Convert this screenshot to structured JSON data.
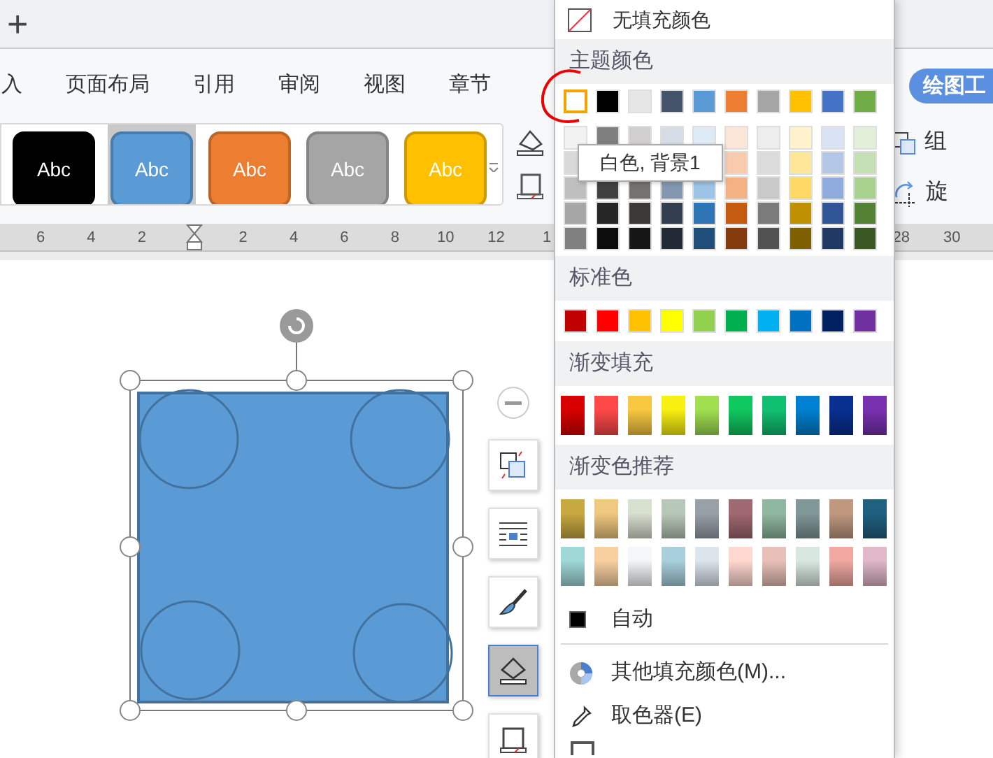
{
  "tab_bar": {
    "new_tab": "+"
  },
  "ribbon": {
    "tabs": [
      {
        "label": "入",
        "selected": false
      },
      {
        "label": "页面布局",
        "selected": false
      },
      {
        "label": "引用",
        "selected": false
      },
      {
        "label": "审阅",
        "selected": false
      },
      {
        "label": "视图",
        "selected": false
      },
      {
        "label": "章节",
        "selected": false
      }
    ],
    "tool_tab": {
      "label": "绘图工",
      "selected": true
    },
    "styles": [
      {
        "label": "Abc",
        "color": "#000000",
        "selected": false
      },
      {
        "label": "Abc",
        "color": "#5b9bd5",
        "selected": true
      },
      {
        "label": "Abc",
        "color": "#ed7d31",
        "selected": false
      },
      {
        "label": "Abc",
        "color": "#a5a5a5",
        "selected": false
      },
      {
        "label": "Abc",
        "color": "#ffc000",
        "selected": false
      }
    ],
    "right_commands": [
      {
        "kind": "group",
        "label": "组"
      },
      {
        "kind": "rotate",
        "label": "旋"
      }
    ]
  },
  "ruler": {
    "marks": [
      "6",
      "4",
      "2",
      "2",
      "4",
      "6",
      "8",
      "10",
      "12",
      "1",
      "28",
      "30"
    ]
  },
  "fill_menu": {
    "no_fill": "无填充颜色",
    "theme_title": "主题颜色",
    "theme_colors": [
      {
        "color": "#ffffff",
        "selected": true
      },
      {
        "color": "#000000",
        "selected": false
      },
      {
        "color": "#e7e6e6",
        "selected": false
      },
      {
        "color": "#44546a",
        "selected": false
      },
      {
        "color": "#5b9bd5",
        "selected": false
      },
      {
        "color": "#ed7d31",
        "selected": false
      },
      {
        "color": "#a5a5a5",
        "selected": false
      },
      {
        "color": "#ffc000",
        "selected": false
      },
      {
        "color": "#4472c4",
        "selected": false
      },
      {
        "color": "#70ad47",
        "selected": false
      }
    ],
    "shade_rows": [
      {
        "swatches": [
          {
            "color": "#f2f2f2"
          },
          {
            "color": "#7f7f7f"
          },
          {
            "color": "#d0cece"
          },
          {
            "color": "#d6dce5"
          },
          {
            "color": "#deebf7"
          },
          {
            "color": "#fbe5d6"
          },
          {
            "color": "#ededed"
          },
          {
            "color": "#fff2cc"
          },
          {
            "color": "#dae3f3"
          },
          {
            "color": "#e2f0d9"
          }
        ]
      },
      {
        "swatches": [
          {
            "color": "#d9d9d9"
          },
          {
            "color": "#f8cbad"
          },
          {
            "color": "#dbdbdb"
          },
          {
            "color": "#ffe699"
          },
          {
            "color": "#b4c7e7"
          },
          {
            "color": "#c5e0b4"
          }
        ]
      },
      {
        "swatches": [
          {
            "color": "#bfbfbf"
          },
          {
            "color": "#404040"
          },
          {
            "color": "#757171"
          },
          {
            "color": "#8497b0"
          },
          {
            "color": "#9dc3e6"
          },
          {
            "color": "#f4b183"
          },
          {
            "color": "#c9c9c9"
          },
          {
            "color": "#ffd966"
          },
          {
            "color": "#8faadc"
          },
          {
            "color": "#a9d18e"
          }
        ]
      },
      {
        "swatches": [
          {
            "color": "#a6a6a6"
          },
          {
            "color": "#262626"
          },
          {
            "color": "#3b3838"
          },
          {
            "color": "#333f50"
          },
          {
            "color": "#2e75b6"
          },
          {
            "color": "#c55a11"
          },
          {
            "color": "#7b7b7b"
          },
          {
            "color": "#bf9000"
          },
          {
            "color": "#2f5597"
          },
          {
            "color": "#548235"
          }
        ]
      },
      {
        "swatches": [
          {
            "color": "#808080"
          },
          {
            "color": "#0d0d0d"
          },
          {
            "color": "#171616"
          },
          {
            "color": "#222a35"
          },
          {
            "color": "#1f4e79"
          },
          {
            "color": "#843c0c"
          },
          {
            "color": "#525252"
          },
          {
            "color": "#7f6000"
          },
          {
            "color": "#203864"
          },
          {
            "color": "#385723"
          }
        ]
      }
    ],
    "tooltip": "白色, 背景1",
    "standard_title": "标准色",
    "standard_colors": [
      {
        "color": "#c00000"
      },
      {
        "color": "#ff0000"
      },
      {
        "color": "#ffc000"
      },
      {
        "color": "#ffff00"
      },
      {
        "color": "#92d050"
      },
      {
        "color": "#00b050"
      },
      {
        "color": "#00b0f0"
      },
      {
        "color": "#0070c0"
      },
      {
        "color": "#002060"
      },
      {
        "color": "#7030a0"
      }
    ],
    "gradient_title": "渐变填充",
    "gradients": [
      {
        "color": "#d80000"
      },
      {
        "color": "#ff4848"
      },
      {
        "color": "#f8c840"
      },
      {
        "color": "#f8f010"
      },
      {
        "color": "#a0e050"
      },
      {
        "color": "#10c860"
      },
      {
        "color": "#10c070"
      },
      {
        "color": "#0080d0"
      },
      {
        "color": "#083090"
      },
      {
        "color": "#7830b0"
      }
    ],
    "recommended_title": "渐变色推荐",
    "recommended_rows": [
      {
        "swatches": [
          {
            "color": "#c8a840"
          },
          {
            "color": "#f0c880"
          },
          {
            "color": "#d8e0d0"
          },
          {
            "color": "#b8c8b8"
          },
          {
            "color": "#98a0a8"
          },
          {
            "color": "#a06870"
          },
          {
            "color": "#90b8a0"
          },
          {
            "color": "#809898"
          },
          {
            "color": "#c09880"
          },
          {
            "color": "#206080"
          }
        ]
      },
      {
        "swatches": [
          {
            "color": "#a0d8d8"
          },
          {
            "color": "#f8d0a0"
          },
          {
            "color": "#f4f6f8"
          },
          {
            "color": "#a8d0dc"
          },
          {
            "color": "#dce4ec"
          },
          {
            "color": "#ffd8d0"
          },
          {
            "color": "#e8c0b8"
          },
          {
            "color": "#d8e8e0"
          },
          {
            "color": "#f0a8a0"
          },
          {
            "color": "#e0b8c8"
          }
        ]
      }
    ],
    "actions": [
      {
        "kind": "auto",
        "label": "自动"
      },
      {
        "kind": "more",
        "label": "其他填充颜色(M)..."
      },
      {
        "kind": "picker",
        "label": "取色器(E)"
      }
    ]
  }
}
